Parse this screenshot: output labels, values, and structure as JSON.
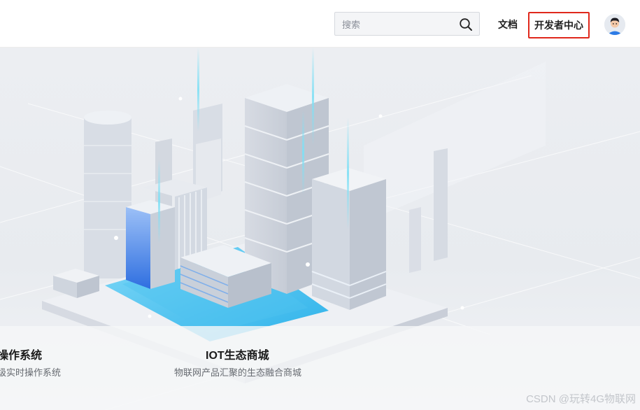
{
  "header": {
    "search": {
      "placeholder": "搜索",
      "value": ""
    },
    "nav": {
      "docs_label": "文档",
      "developer_center_label": "开发者中心"
    },
    "icons": {
      "search": "search-icon",
      "avatar": "user-avatar"
    }
  },
  "hero": {
    "features": [
      {
        "title": "操作系统",
        "desc": "级实时操作系统"
      },
      {
        "title": "IOT生态商城",
        "desc": "物联网产品汇聚的生态融合商城"
      }
    ]
  },
  "watermark": "CSDN @玩转4G物联网",
  "colors": {
    "accent_red": "#e0281c",
    "water_blue": "#4fc3f0",
    "glass_blue": "#2f6fe0"
  }
}
